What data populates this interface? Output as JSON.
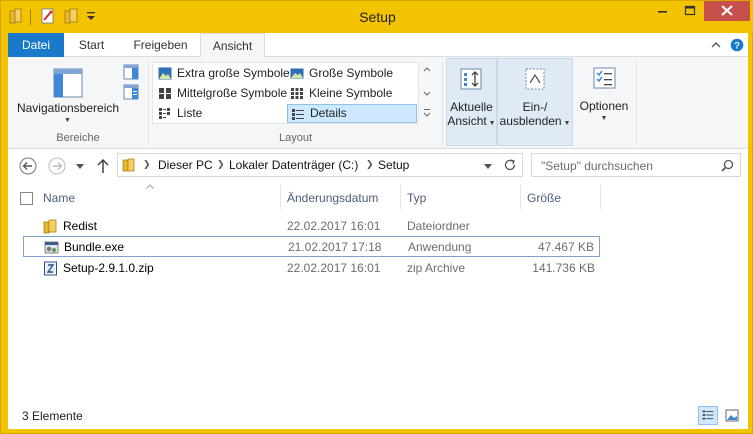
{
  "window": {
    "title": "Setup"
  },
  "ribbon_tabs": [
    {
      "label": "Datei"
    },
    {
      "label": "Start"
    },
    {
      "label": "Freigeben"
    },
    {
      "label": "Ansicht"
    }
  ],
  "ribbon": {
    "panes": {
      "nav_label": "Navigationsbereich",
      "group_label": "Bereiche"
    },
    "layout": {
      "group_label": "Layout",
      "items": [
        {
          "label": "Extra große Symbole"
        },
        {
          "label": "Große Symbole"
        },
        {
          "label": "Mittelgroße Symbole"
        },
        {
          "label": "Kleine Symbole"
        },
        {
          "label": "Liste"
        },
        {
          "label": "Details"
        }
      ],
      "selected": "Details"
    },
    "current_view": {
      "line1": "Aktuelle",
      "line2": "Ansicht"
    },
    "show_hide": {
      "line1": "Ein-/",
      "line2": "ausblenden"
    },
    "options": {
      "label": "Optionen"
    }
  },
  "address": {
    "crumbs": [
      "Dieser PC",
      "Lokaler Datenträger (C:)",
      "Setup"
    ]
  },
  "search": {
    "placeholder": "\"Setup\" durchsuchen"
  },
  "columns": {
    "name": "Name",
    "date": "Änderungsdatum",
    "type": "Typ",
    "size": "Größe"
  },
  "files": [
    {
      "name": "Redist",
      "date": "22.02.2017 16:01",
      "type": "Dateiordner",
      "size": "",
      "icon": "folder-icon"
    },
    {
      "name": "Bundle.exe",
      "date": "21.02.2017 17:18",
      "type": "Anwendung",
      "size": "47.467 KB",
      "icon": "application-icon"
    },
    {
      "name": "Setup-2.9.1.0.zip",
      "date": "22.02.2017 16:01",
      "type": "zip Archive",
      "size": "141.736 KB",
      "icon": "zip-archive-icon"
    }
  ],
  "status": {
    "count": "3 Elemente"
  },
  "colors": {
    "title_bar": "#f3c300",
    "datei_tab": "#1979ca",
    "selection": "#cde8ff",
    "close_button": "#c7504a"
  }
}
